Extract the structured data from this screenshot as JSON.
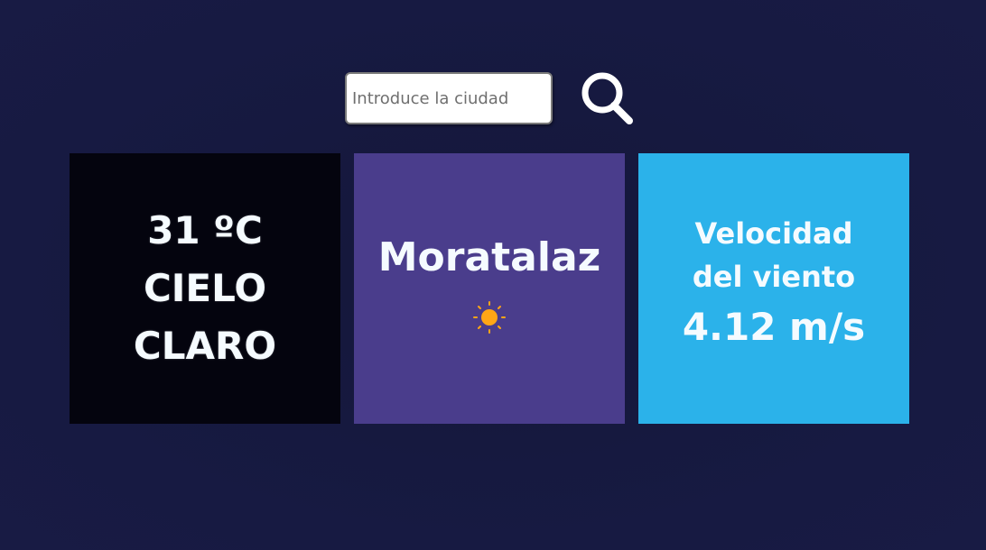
{
  "search": {
    "placeholder": "Introduce la ciudad",
    "value": "",
    "button_icon": "search-icon"
  },
  "weather": {
    "temperature": "31 ºC",
    "description": "CIELO CLARO",
    "city": "Moratalaz",
    "condition_icon": "sun-icon",
    "wind_label": "Velocidad del viento",
    "wind_speed": "4.12 m/s"
  },
  "colors": {
    "background": "#161a40",
    "card_temperature": "#04040e",
    "card_city": "#4a3d8c",
    "card_wind": "#2bb2ea",
    "sun": "#ffa616",
    "text": "#f5fbff"
  }
}
